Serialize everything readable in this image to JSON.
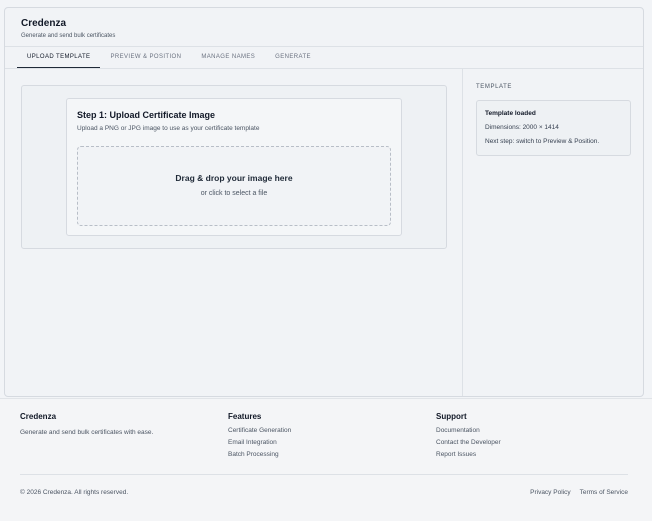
{
  "app": {
    "title": "Credenza",
    "subtitle": "Generate and send bulk certificates"
  },
  "tabs": [
    {
      "label": "Upload Template",
      "active": true
    },
    {
      "label": "Preview & Position",
      "active": false
    },
    {
      "label": "Manage Names",
      "active": false
    },
    {
      "label": "Generate",
      "active": false
    }
  ],
  "upload": {
    "step_title": "Step 1: Upload Certificate Image",
    "description": "Upload a PNG or JPG image to use as your certificate template",
    "dropzone_title": "Drag & drop your image here",
    "dropzone_subtitle": "or click to select a file"
  },
  "sidebar": {
    "heading": "Template",
    "status_title": "Template loaded",
    "dimensions": "Dimensions: 2000 × 1414",
    "next_step": "Next step: switch to Preview & Position."
  },
  "footer": {
    "brand": {
      "title": "Credenza",
      "tagline": "Generate and send bulk certificates with ease."
    },
    "features": {
      "heading": "Features",
      "links": [
        "Certificate Generation",
        "Email Integration",
        "Batch Processing"
      ]
    },
    "support": {
      "heading": "Support",
      "links": [
        "Documentation",
        "Contact the Developer",
        "Report Issues"
      ]
    },
    "copyright": "© 2026 Credenza. All rights reserved.",
    "legal": [
      "Privacy Policy",
      "Terms of Service"
    ]
  }
}
